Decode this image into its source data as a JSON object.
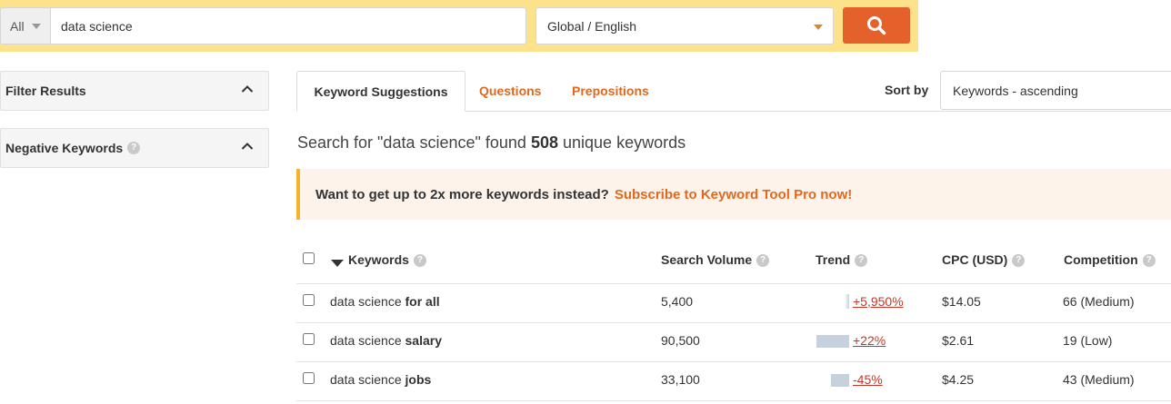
{
  "search": {
    "scope": "All",
    "query": "data science",
    "locale": "Global / English"
  },
  "sidebar": {
    "filter_results": "Filter Results",
    "negative_keywords": "Negative Keywords"
  },
  "tabs": [
    {
      "label": "Keyword Suggestions",
      "active": true
    },
    {
      "label": "Questions",
      "active": false
    },
    {
      "label": "Prepositions",
      "active": false
    }
  ],
  "sort": {
    "label": "Sort by",
    "value": "Keywords - ascending"
  },
  "summary": {
    "prefix": "Search for \"data science\" found",
    "count": "508",
    "suffix": "unique keywords"
  },
  "promo": {
    "text": "Want to get up to 2x more keywords instead?",
    "link": "Subscribe to Keyword Tool Pro now!"
  },
  "table": {
    "headers": {
      "keywords": "Keywords",
      "search_volume": "Search Volume",
      "trend": "Trend",
      "cpc": "CPC (USD)",
      "competition": "Competition"
    },
    "rows": [
      {
        "base": "data science",
        "suffix": "for all",
        "volume": "5,400",
        "trend": "+5,950%",
        "trend_level": 0.12,
        "cpc": "$14.05",
        "competition": "66 (Medium)"
      },
      {
        "base": "data science",
        "suffix": "salary",
        "volume": "90,500",
        "trend": "+22%",
        "trend_level": 1.0,
        "cpc": "$2.61",
        "competition": "19 (Low)"
      },
      {
        "base": "data science",
        "suffix": "jobs",
        "volume": "33,100",
        "trend": "-45%",
        "trend_level": 0.55,
        "cpc": "$4.25",
        "competition": "43 (Medium)"
      }
    ]
  },
  "colors": {
    "accent": "#e0691f",
    "search_button": "#e4612b",
    "topbar": "#fbe28b",
    "trend_bar": "#c5d2de"
  },
  "icons": {
    "search": "search-icon",
    "help": "help-icon",
    "chevron": "chevron-up-icon",
    "sort_arrow": "sort-down-icon"
  }
}
